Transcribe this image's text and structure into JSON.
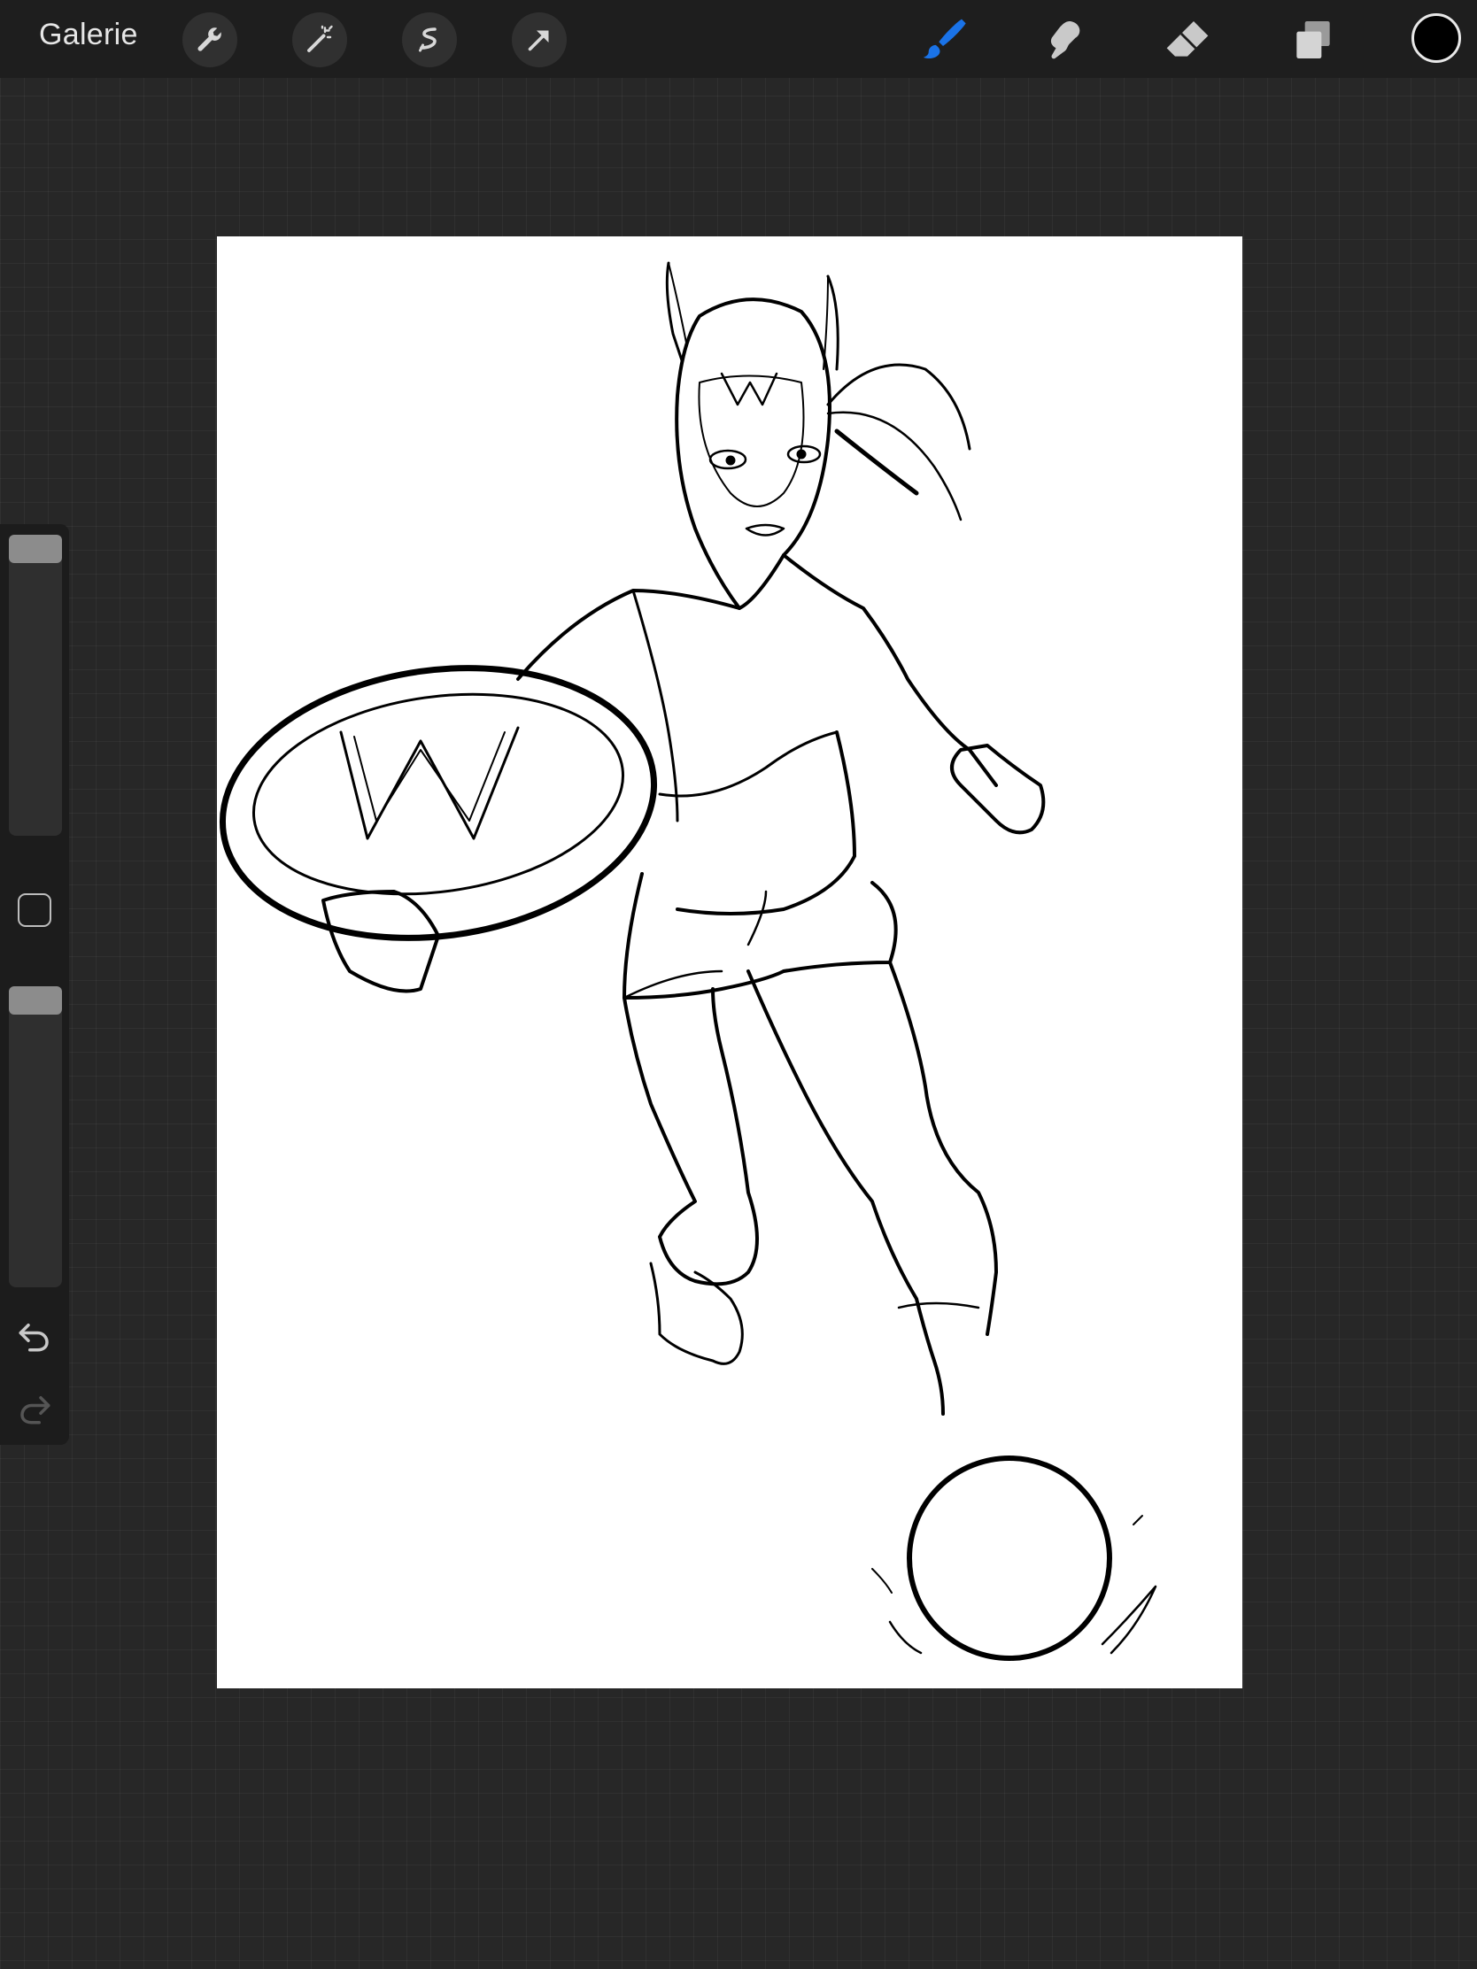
{
  "topbar": {
    "gallery_label": "Galerie",
    "left_tools": [
      "wrench-icon",
      "magic-wand-icon",
      "selection-icon",
      "transform-arrow-icon"
    ],
    "right_tools": [
      "brush-icon",
      "smudge-icon",
      "eraser-icon",
      "layers-icon"
    ],
    "active_tool": "brush-icon",
    "accent_color": "#1a73e8",
    "current_color": "#000000"
  },
  "sidebar": {
    "brush_size_level": 0.0,
    "opacity_level": 0.0,
    "icons": [
      "modify-square-icon",
      "undo-icon",
      "redo-icon"
    ]
  },
  "canvas": {
    "background": "#ffffff",
    "content": "line-art-illustration"
  }
}
